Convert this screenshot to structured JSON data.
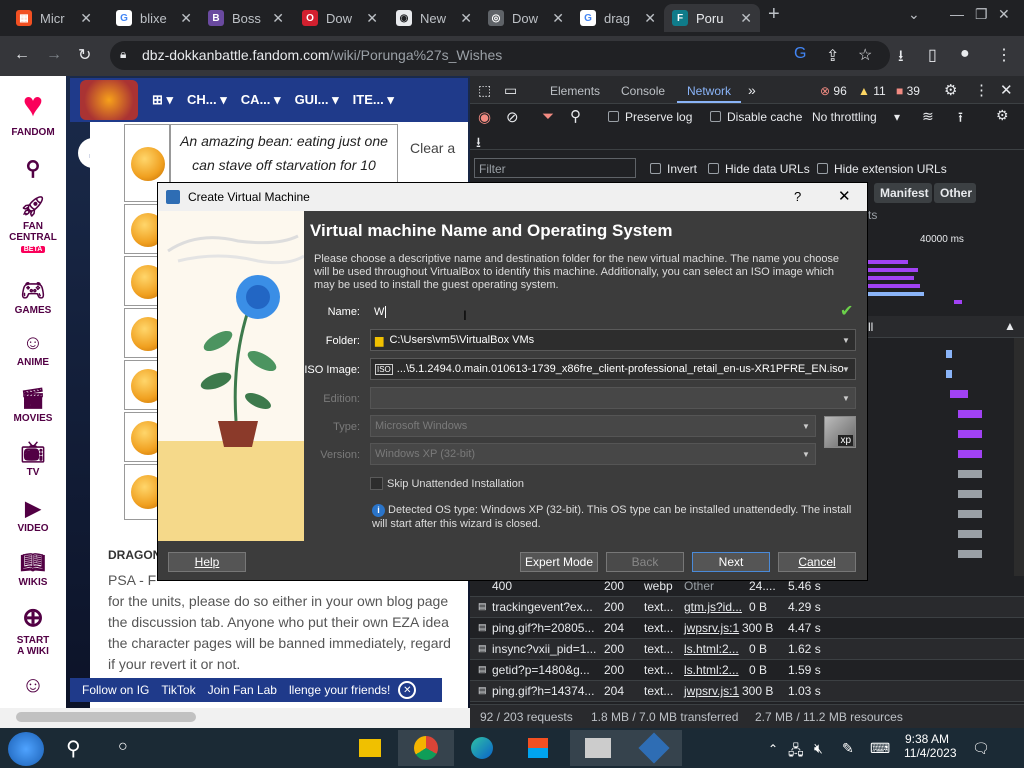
{
  "browser": {
    "tabs": [
      {
        "label": "Micr",
        "icon": "microsoft-icon",
        "color": "#f25022"
      },
      {
        "label": "blixe",
        "icon": "google-icon",
        "color": "#4285f4"
      },
      {
        "label": "Boss",
        "icon": "boss-icon",
        "color": "#6a4aa0"
      },
      {
        "label": "Dow",
        "icon": "opera-icon",
        "color": "#d2202f"
      },
      {
        "label": "New",
        "icon": "chrome-icon",
        "color": "#5f6368"
      },
      {
        "label": "Dow",
        "icon": "globe-icon",
        "color": "#5f6368"
      },
      {
        "label": "drag",
        "icon": "google-icon",
        "color": "#4285f4"
      },
      {
        "label": "Poru",
        "icon": "fandom-icon",
        "color": "#0f7b8a"
      }
    ],
    "url_domain": "dbz-dokkanbattle.fandom.com",
    "url_path": "/wiki/Porunga%27s_Wishes"
  },
  "fandom_rail": {
    "brand": "FANDOM",
    "items": [
      {
        "label": "FAN CENTRAL",
        "badge": "BETA",
        "icon": "rocket-icon"
      },
      {
        "label": "GAMES",
        "icon": "gamepad-icon"
      },
      {
        "label": "ANIME",
        "icon": "anime-icon"
      },
      {
        "label": "MOVIES",
        "icon": "movies-icon"
      },
      {
        "label": "TV",
        "icon": "tv-icon"
      },
      {
        "label": "VIDEO",
        "icon": "video-icon"
      },
      {
        "label": "WIKIS",
        "icon": "wikis-icon"
      },
      {
        "label": "START A WIKI",
        "icon": "plus-icon"
      }
    ]
  },
  "wiki": {
    "nav": [
      "CH...",
      "CA...",
      "GUI...",
      "ITE..."
    ],
    "quote": "An amazing bean: eating just one can stave off starvation for 10",
    "clear": "Clear a",
    "section_title": "DRAGON",
    "body_lines": [
      "PSA - F",
      "for the units, please do so either in your own blog page",
      "the discussion tab. Anyone who put their own EZA idea",
      "the character pages will be banned immediately, regard",
      "if your revert it or not."
    ],
    "bottom_links": [
      "Follow on IG",
      "TikTok",
      "Join Fan Lab",
      "llenge your friends!"
    ]
  },
  "devtools": {
    "tabs": [
      "Elements",
      "Console",
      "Network"
    ],
    "active_tab": "Network",
    "errors": "96",
    "warnings": "11",
    "issues": "39",
    "preserve_log": "Preserve log",
    "disable_cache": "Disable cache",
    "throttling": "No throttling",
    "filter_placeholder": "Filter",
    "invert": "Invert",
    "hide_data_urls": "Hide data URLs",
    "hide_extension_urls": "Hide extension URLs",
    "type_chips": [
      "Manifest",
      "Other"
    ],
    "timeline_label": "40000 ms",
    "all_label": "ll",
    "rows": [
      {
        "name": "400",
        "status": "200",
        "type": "webp",
        "initiator": "Other",
        "size": "24....",
        "time": "5.46 s"
      },
      {
        "name": "trackingevent?ex...",
        "status": "200",
        "type": "text...",
        "initiator": "gtm.js?id...",
        "size": "0 B",
        "time": "4.29 s"
      },
      {
        "name": "ping.gif?h=20805...",
        "status": "204",
        "type": "text...",
        "initiator": "jwpsrv.js:1",
        "size": "300 B",
        "time": "4.47 s"
      },
      {
        "name": "insync?vxii_pid=1...",
        "status": "200",
        "type": "text...",
        "initiator": "ls.html:2...",
        "size": "0 B",
        "time": "1.62 s"
      },
      {
        "name": "getid?p=1480&g...",
        "status": "200",
        "type": "text...",
        "initiator": "ls.html:2...",
        "size": "0 B",
        "time": "1.59 s"
      },
      {
        "name": "ping.gif?h=14374...",
        "status": "204",
        "type": "text...",
        "initiator": "jwpsrv.js:1",
        "size": "300 B",
        "time": "1.03 s"
      }
    ],
    "status_bar": {
      "requests": "92 / 203 requests",
      "transferred": "1.8 MB / 7.0 MB transferred",
      "resources": "2.7 MB / 11.2 MB resources"
    }
  },
  "dialog": {
    "window_title": "Create Virtual Machine",
    "help_q": "?",
    "heading": "Virtual machine Name and Operating System",
    "description": "Please choose a descriptive name and destination folder for the new virtual machine. The name you choose will be used throughout VirtualBox to identify this machine. Additionally, you can select an ISO image which may be used to install the guest operating system.",
    "name_label": "Name:",
    "name_value": "W",
    "folder_label": "Folder:",
    "folder_value": "C:\\Users\\vm5\\VirtualBox VMs",
    "iso_label": "ISO Image:",
    "iso_value": "...\\5.1.2494.0.main.010613-1739_x86fre_client-professional_retail_en-us-XR1PFRE_EN.iso",
    "edition_label": "Edition:",
    "edition_value": "",
    "type_label": "Type:",
    "type_value": "Microsoft Windows",
    "version_label": "Version:",
    "version_value": "Windows XP (32-bit)",
    "os_badge": "xp",
    "skip_unattended": "Skip Unattended Installation",
    "info": "Detected OS type: Windows XP (32-bit). This OS type can be installed unattendedly. The install will start after this wizard is closed.",
    "buttons": {
      "help": "Help",
      "expert": "Expert Mode",
      "back": "Back",
      "next": "Next",
      "cancel": "Cancel"
    }
  },
  "taskbar": {
    "time": "9:38 AM",
    "date": "11/4/2023"
  }
}
